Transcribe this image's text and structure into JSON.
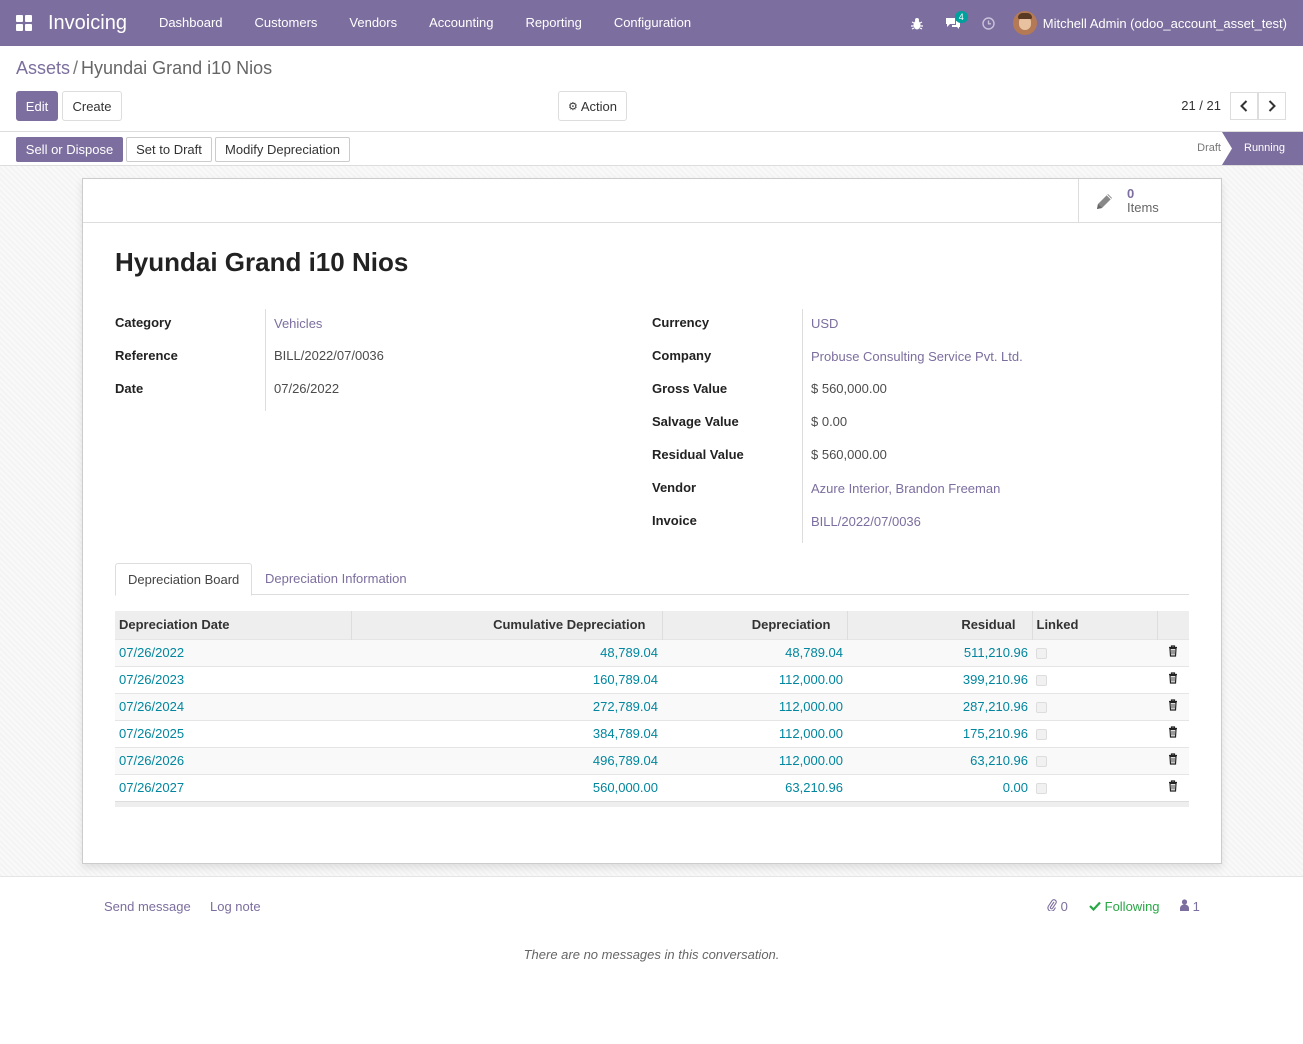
{
  "navbar": {
    "app_name": "Invoicing",
    "menu": [
      "Dashboard",
      "Customers",
      "Vendors",
      "Accounting",
      "Reporting",
      "Configuration"
    ],
    "messages_badge": "4",
    "user_name": "Mitchell Admin (odoo_account_asset_test)"
  },
  "breadcrumb": {
    "parent": "Assets",
    "separator": "/",
    "current": "Hyundai Grand i10 Nios"
  },
  "control": {
    "edit_label": "Edit",
    "create_label": "Create",
    "action_label": "Action",
    "pager": "21 / 21"
  },
  "statusbar": {
    "buttons": [
      "Sell or Dispose",
      "Set to Draft",
      "Modify Depreciation"
    ],
    "stages": {
      "draft": "Draft",
      "running": "Running"
    }
  },
  "stat_button": {
    "value": "0",
    "label": "Items"
  },
  "record": {
    "title": "Hyundai Grand i10 Nios",
    "left_fields": [
      {
        "label": "Category",
        "value": "Vehicles"
      },
      {
        "label": "Reference",
        "value": "BILL/2022/07/0036"
      },
      {
        "label": "Date",
        "value": "07/26/2022"
      }
    ],
    "right_fields": [
      {
        "label": "Currency",
        "value": "USD"
      },
      {
        "label": "Company",
        "value": "Probuse Consulting Service Pvt. Ltd."
      },
      {
        "label": "Gross Value",
        "value": "$ 560,000.00"
      },
      {
        "label": "Salvage Value",
        "value": "$ 0.00"
      },
      {
        "label": "Residual Value",
        "value": "$ 560,000.00"
      },
      {
        "label": "Vendor",
        "value": "Azure Interior, Brandon Freeman"
      },
      {
        "label": "Invoice",
        "value": "BILL/2022/07/0036"
      }
    ]
  },
  "tabs": [
    "Depreciation Board",
    "Depreciation Information"
  ],
  "table": {
    "headers": [
      "Depreciation Date",
      "Cumulative Depreciation",
      "Depreciation",
      "Residual",
      "Linked"
    ],
    "rows": [
      [
        "07/26/2022",
        "48,789.04",
        "48,789.04",
        "511,210.96"
      ],
      [
        "07/26/2023",
        "160,789.04",
        "112,000.00",
        "399,210.96"
      ],
      [
        "07/26/2024",
        "272,789.04",
        "112,000.00",
        "287,210.96"
      ],
      [
        "07/26/2025",
        "384,789.04",
        "112,000.00",
        "175,210.96"
      ],
      [
        "07/26/2026",
        "496,789.04",
        "112,000.00",
        "63,210.96"
      ],
      [
        "07/26/2027",
        "560,000.00",
        "63,210.96",
        "0.00"
      ]
    ]
  },
  "chatter": {
    "send_message": "Send message",
    "log_note": "Log note",
    "attachments": "0",
    "following": "Following",
    "followers": "1",
    "empty": "There are no messages in this conversation."
  },
  "colors": {
    "brand": "#7c6e9e",
    "link": "#00869e",
    "following": "#28a745"
  }
}
